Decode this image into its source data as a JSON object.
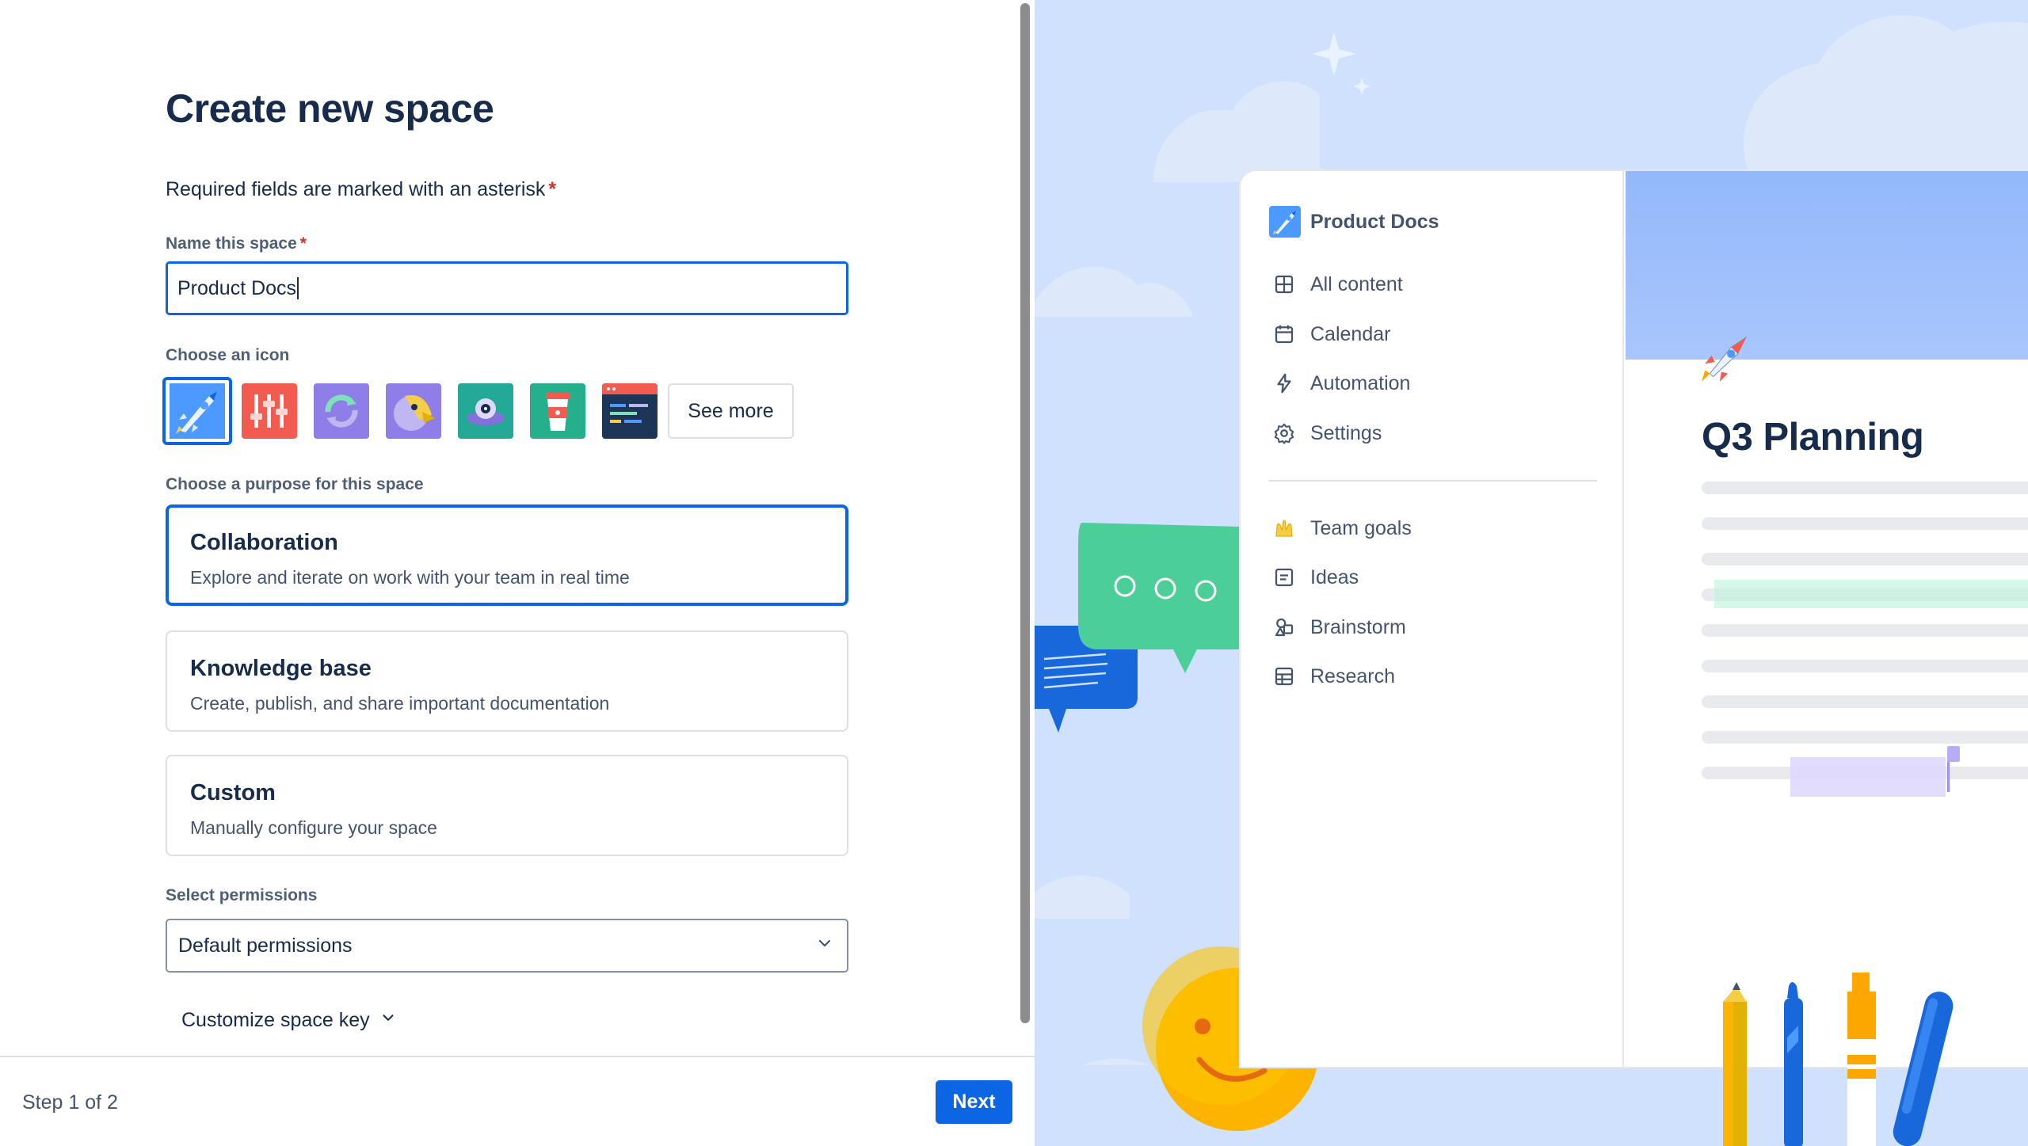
{
  "form": {
    "title": "Create new space",
    "required_note": "Required fields are marked with an asterisk",
    "required_marker": "*",
    "name_label": "Name this space",
    "name_value": "Product Docs",
    "icon_label": "Choose an icon",
    "icons": [
      "rocket-icon",
      "sliders-icon",
      "sync-icon",
      "parrot-icon",
      "ufo-icon",
      "coffee-cup-icon",
      "code-window-icon"
    ],
    "selected_icon": "rocket-icon",
    "see_more_label": "See more",
    "purpose_label": "Choose a purpose for this space",
    "purposes": [
      {
        "title": "Collaboration",
        "description": "Explore and iterate on work with your team in real time",
        "selected": true
      },
      {
        "title": "Knowledge base",
        "description": "Create, publish, and share important documentation",
        "selected": false
      },
      {
        "title": "Custom",
        "description": "Manually configure your space",
        "selected": false
      }
    ],
    "permissions_label": "Select permissions",
    "permissions_value": "Default permissions",
    "customize_key_label": "Customize space key"
  },
  "footer": {
    "step_text": "Step 1 of 2",
    "next_label": "Next"
  },
  "preview": {
    "space_name": "Product Docs",
    "nav_items": [
      {
        "label": "All content",
        "icon": "grid-icon"
      },
      {
        "label": "Calendar",
        "icon": "calendar-icon"
      },
      {
        "label": "Automation",
        "icon": "lightning-icon"
      },
      {
        "label": "Settings",
        "icon": "gear-icon"
      }
    ],
    "content_items": [
      {
        "label": "Team goals",
        "icon": "raised-hands-emoji"
      },
      {
        "label": "Ideas",
        "icon": "page-icon"
      },
      {
        "label": "Brainstorm",
        "icon": "shapes-icon"
      },
      {
        "label": "Research",
        "icon": "table-icon"
      }
    ],
    "doc_title": "Q3 Planning",
    "doc_emoji": "rocket-emoji"
  },
  "colors": {
    "primary": "#0c66e4",
    "text": "#172b4d",
    "subtle_text": "#44546f",
    "required": "#c9372c",
    "illustration_bg": "#cfe1fd"
  }
}
